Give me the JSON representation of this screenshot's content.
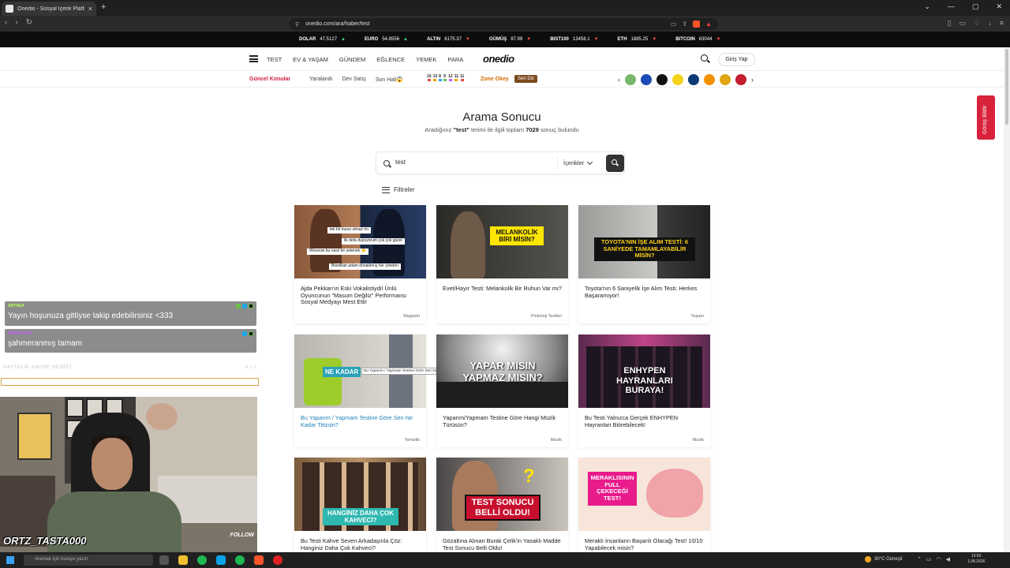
{
  "browser": {
    "tab_title": "Onedio - Sosyal İçerik Platformu",
    "url": "onedio.com/ara/haber/test"
  },
  "ticker": [
    {
      "name": "DOLAR",
      "value": "47.5127",
      "dir": "up"
    },
    {
      "name": "EURO",
      "value": "54.8556",
      "dir": "up"
    },
    {
      "name": "ALTIN",
      "value": "6175.37",
      "dir": "down"
    },
    {
      "name": "GÜMÜŞ",
      "value": "87.99",
      "dir": "down"
    },
    {
      "name": "BIST100",
      "value": "13458.1",
      "dir": "down"
    },
    {
      "name": "ETH",
      "value": "1885.25",
      "dir": "down"
    },
    {
      "name": "BITCOIN",
      "value": "63044",
      "dir": "down"
    }
  ],
  "nav": {
    "items": [
      "TEST",
      "EV & YAŞAM",
      "GÜNDEM",
      "EĞLENCE",
      "YEMEK",
      "PARA"
    ],
    "logo": "onedio",
    "login": "Giriş Yap"
  },
  "subnav": {
    "trending_label": "Güncel Konular",
    "links": [
      "Yaralandı",
      "Dev Satış",
      "Son Hali😱"
    ],
    "lotto": [
      "10",
      "13",
      "8",
      "9",
      "12",
      "11",
      "11"
    ],
    "zone": "Zone Okey",
    "seri": "Seri Diz"
  },
  "search": {
    "title": "Arama Sonucu",
    "sub_pre": "Aradığınız",
    "term": "\"test\"",
    "sub_mid": "terimi ile ilgili toplam",
    "count": "7029",
    "sub_post": "sonuç bulundu",
    "value": "test",
    "select": "İçerikler",
    "filters": "Filtreler"
  },
  "cards": [
    {
      "title": "Ajda Pekkan'ın Eski Vokalistiydi! Ünlü Oyuncunun \"Masum Değiliz\" Performansı Sosyal Medyayı Mest Etti!",
      "category": "Magazin",
      "bubbles": [
        "tek bir kusur olmaz mı",
        "ilk defa duyuyorum çok çok güzel",
        "Woooow bu nasıl bir yetenek 👏",
        "Bismillah adam donatılmış her yönden"
      ]
    },
    {
      "title": "Evet/Hayır Testi: Melankolik Bir Ruhun Var mı?",
      "category": "Psikoloji Testleri",
      "overlay": "MELANKOLİK BİRİ MİSİN?"
    },
    {
      "title": "Toyota'nın 6 Saniyelik İşe Alım Testi: Herkes Başaramıyor!",
      "category": "Yaşam",
      "overlay": "TOYOTA'NIN İŞE ALIM TESTİ: 6 SANİYEDE TAMAMLAYABİLİR MİSİN?"
    },
    {
      "title": "Bu Yaparım / Yapmam Testine Göre Sen Ne Kadar Titizsin?",
      "category": "Temizlik",
      "overlay": "NE KADAR",
      "tooltip": "Bu Yaparım / Yapmam Testine Göre Sen Ne Kadar Titizsin?"
    },
    {
      "title": "Yaparım/Yapmam Testine Göre Hangi Müzik Türüsün?",
      "category": "Müzik",
      "overlay": "YAPAR MISIN YAPMAZ MISIN?"
    },
    {
      "title": "Bu Testi Yalnızca Gerçek ENHYPEN Hayranları Bitirebilecek!",
      "category": "Müzik",
      "overlay": "ENHYPEN HAYRANLARI BURAYA!"
    },
    {
      "title": "Bu Testi Kahve Seven Arkadaşınla Çöz: Hanginiz Daha Çok Kahveci?",
      "category": "",
      "overlay": "HANGİNİZ DAHA ÇOK KAHVECİ?"
    },
    {
      "title": "Gözaltına Alınan Burak Çelik'in Yasaklı Madde Test Sonucu Belli Oldu!",
      "category": "",
      "overlay": "TEST SONUCU BELLİ OLDU!"
    },
    {
      "title": "Meraklı İnsanların Başarılı Olacağı Test! 10/10 Yapabilecek misin?",
      "category": "",
      "overlay": "MERAKLISININ FULL ÇEKECEĞİ TEST!"
    }
  ],
  "side_tab": "Görüş Bildir",
  "stream": {
    "chat": [
      {
        "user": "ARTHEA",
        "message": "Yayın hoşunuza gittiyse takip edebilirsiniz <333",
        "color": "#b8ff4f"
      },
      {
        "user": "RHNNYFURY",
        "message": "şahmeranmış tamam",
        "color": "#c45cff"
      }
    ],
    "goal_label": "HAFTALIK ABONE HEDEFİ",
    "goal_count": "0 / 1",
    "goal_progress": 0,
    "name": "ORTZ_TASTA000",
    "follow": "FOLLOW"
  },
  "taskbar": {
    "search": "Aramak için buraya yazın",
    "weather": "30°C Güneşli",
    "time": "13:50",
    "date": "1.08.2026"
  }
}
